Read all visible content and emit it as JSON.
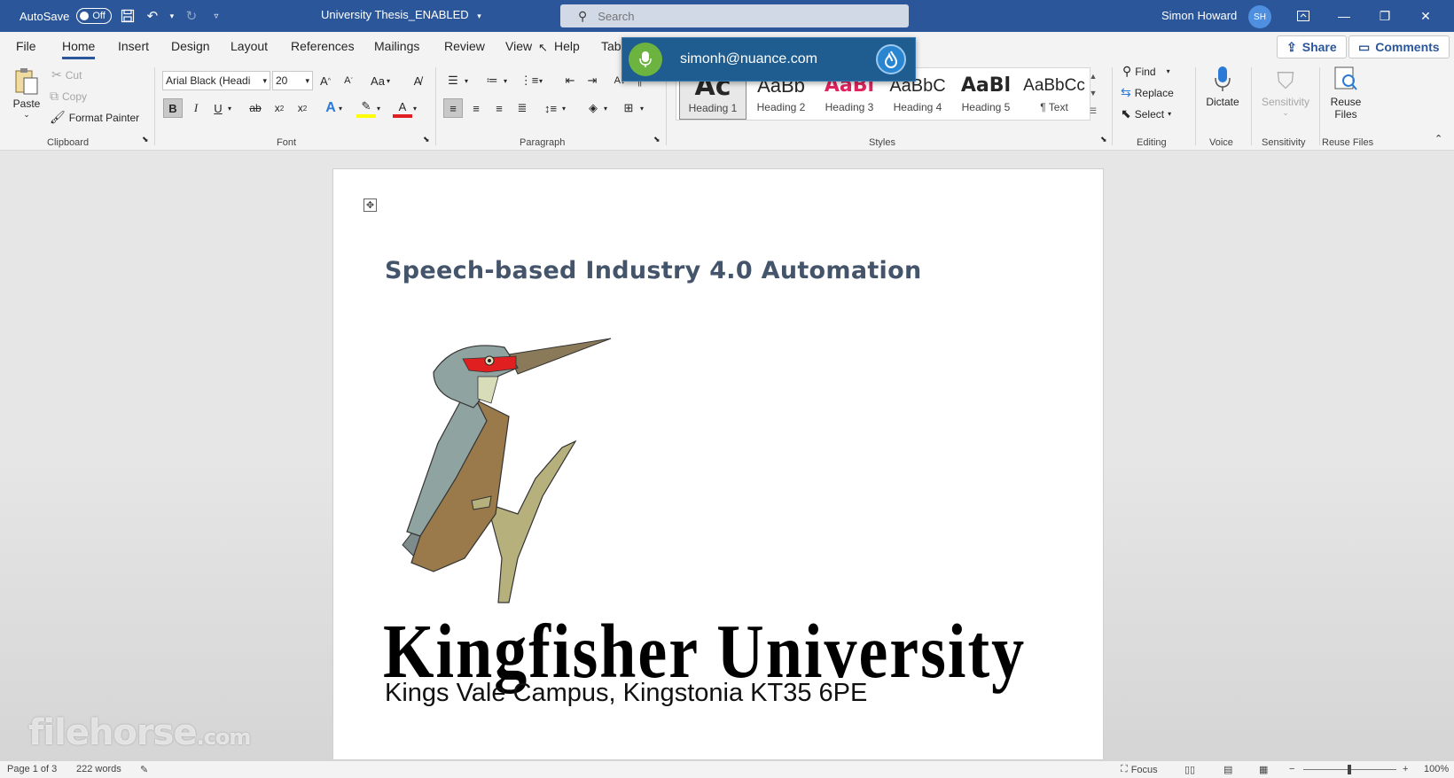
{
  "titlebar": {
    "autosave_label": "AutoSave",
    "autosave_state": "Off",
    "document_title": "University Thesis_ENABLED",
    "search_placeholder": "Search",
    "user_name": "Simon Howard",
    "user_initials": "SH"
  },
  "menu": {
    "tabs": [
      "File",
      "Home",
      "Insert",
      "Design",
      "Layout",
      "References",
      "Mailings",
      "Review",
      "View",
      "Help",
      "Tab"
    ],
    "active_tab": "Home",
    "share_label": "Share",
    "comments_label": "Comments"
  },
  "dragon": {
    "email": "simonh@nuance.com"
  },
  "ribbon": {
    "clipboard": {
      "paste": "Paste",
      "cut": "Cut",
      "copy": "Copy",
      "format_painter": "Format Painter",
      "label": "Clipboard"
    },
    "font": {
      "family": "Arial Black (Headi",
      "size": "20",
      "label": "Font",
      "case_label": "Aa"
    },
    "paragraph": {
      "label": "Paragraph"
    },
    "styles": {
      "label": "Styles",
      "items": [
        {
          "sample": "Ac",
          "name": "Heading 1"
        },
        {
          "sample": "AaBb",
          "name": "Heading 2"
        },
        {
          "sample": "AaBl",
          "name": "Heading 3"
        },
        {
          "sample": "AaBbC",
          "name": "Heading 4"
        },
        {
          "sample": "AaBl",
          "name": "Heading 5"
        },
        {
          "sample": "AaBbCc",
          "name": "¶ Text"
        }
      ]
    },
    "editing": {
      "find": "Find",
      "replace": "Replace",
      "select": "Select",
      "label": "Editing"
    },
    "voice": {
      "dictate": "Dictate",
      "label": "Voice"
    },
    "sensitivity": {
      "button": "Sensitivity",
      "label": "Sensitivity"
    },
    "reuse": {
      "button_line1": "Reuse",
      "button_line2": "Files",
      "label": "Reuse Files"
    }
  },
  "document": {
    "heading": "Speech-based Industry 4.0 Automation",
    "university": "Kingfisher University",
    "campus": "Kings Vale Campus, Kingstonia KT35 6PE"
  },
  "watermark": {
    "main": "filehorse",
    "suffix": ".com"
  },
  "status": {
    "page": "Page 1 of 3",
    "words": "222 words",
    "focus": "Focus",
    "zoom": "100%"
  },
  "colors": {
    "titlebar": "#2b579a",
    "heading_text": "#44546a",
    "dragon_bg": "#1f5d90",
    "mic_green": "#6db33f",
    "heading3_red": "#e0245e"
  }
}
